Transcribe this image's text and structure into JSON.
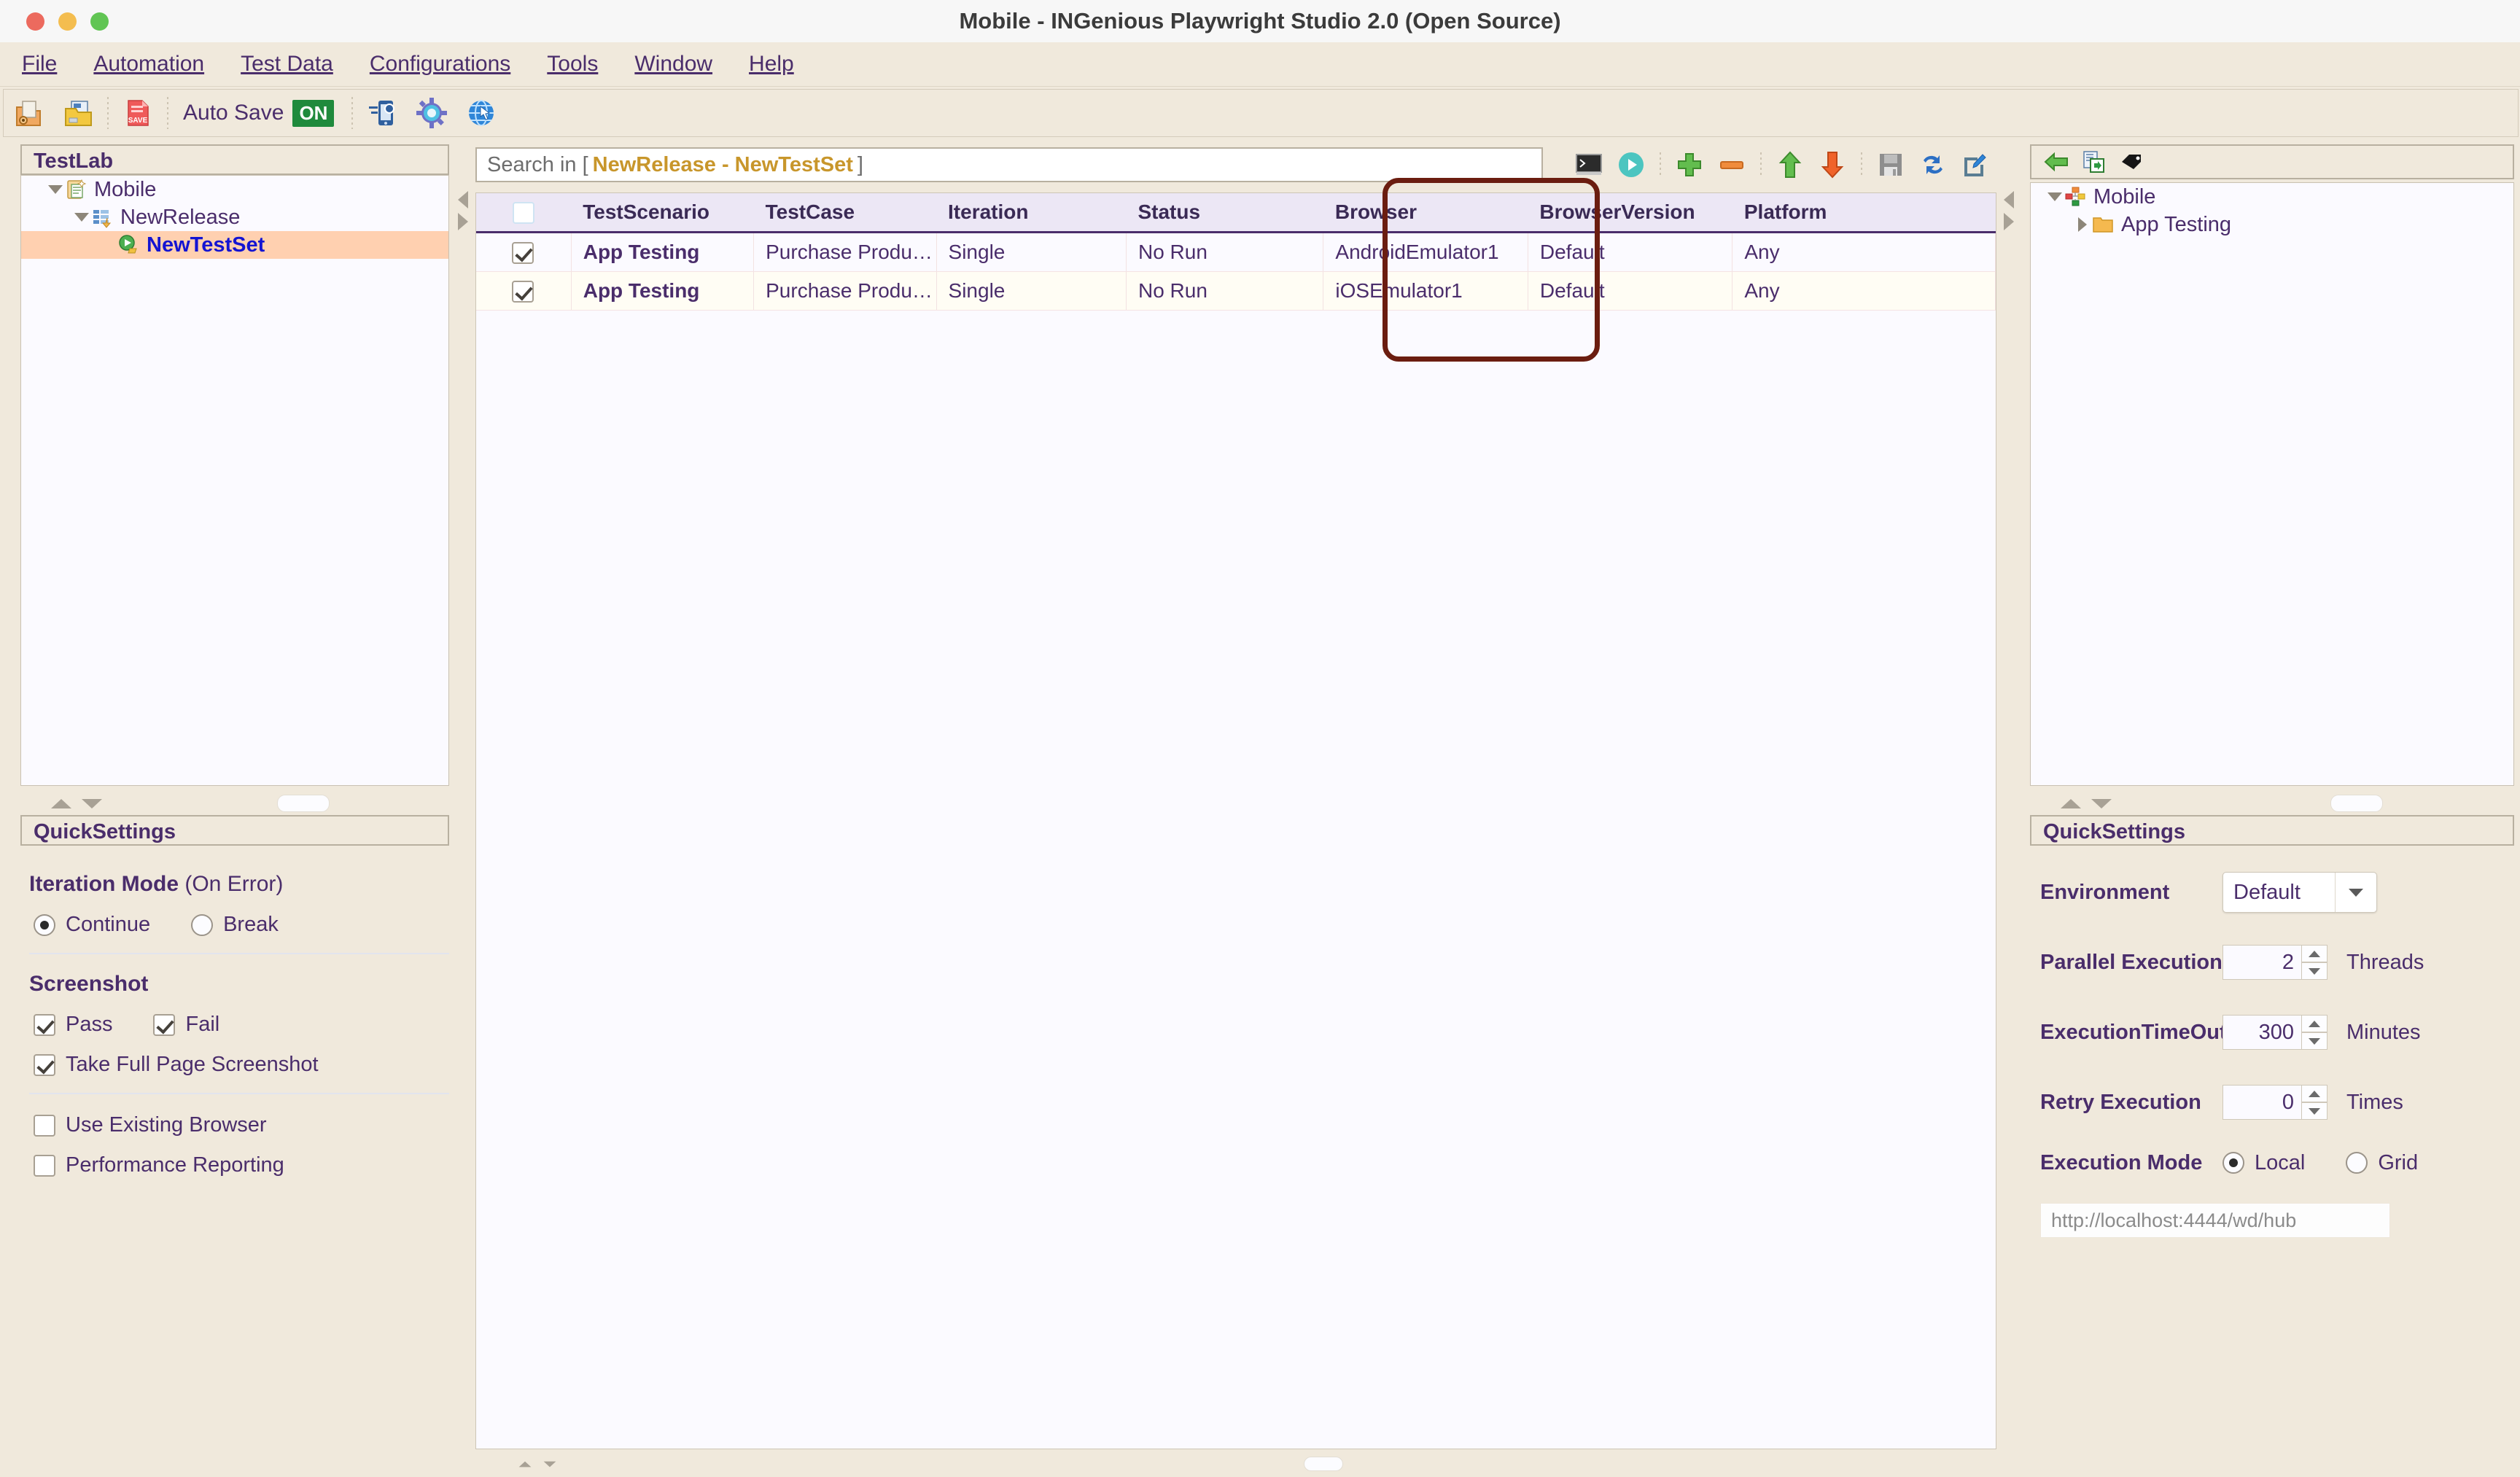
{
  "window": {
    "title": "Mobile - INGenious Playwright Studio 2.0 (Open Source)",
    "close_label": "close",
    "minimize_label": "minimize",
    "zoom_label": "zoom"
  },
  "menubar": {
    "items": [
      {
        "label": "File",
        "mnemonic": "F"
      },
      {
        "label": "Automation",
        "mnemonic": "A"
      },
      {
        "label": "Test Data",
        "mnemonic": "D"
      },
      {
        "label": "Configurations",
        "mnemonic": "C"
      },
      {
        "label": "Tools",
        "mnemonic": "T"
      },
      {
        "label": "Window",
        "mnemonic": "W"
      },
      {
        "label": "Help",
        "mnemonic": "H"
      }
    ]
  },
  "toolbar": {
    "open_icon": "open-project-icon",
    "save_project_icon": "save-project-folder-icon",
    "save_icon": "save-file-icon",
    "autosave_label": "Auto Save",
    "autosave_state": "ON",
    "mobile_config_icon": "mobile-settings-icon",
    "settings_icon": "gear-icon",
    "web_icon": "globe-pointer-icon"
  },
  "left_panel": {
    "title": "TestLab",
    "tree": [
      {
        "label": "Mobile",
        "level": 0,
        "expanded": true,
        "icon": "project-clipboard-icon",
        "selected": false
      },
      {
        "label": "NewRelease",
        "level": 1,
        "expanded": true,
        "icon": "release-list-icon",
        "selected": false
      },
      {
        "label": "NewTestSet",
        "level": 2,
        "expanded": null,
        "icon": "testset-play-icon",
        "selected": true
      }
    ]
  },
  "center": {
    "search": {
      "prefix": "Search in [",
      "scope": "NewRelease - NewTestSet",
      "suffix": "]",
      "placeholder": "Search in [ NewRelease - NewTestSet ]"
    },
    "tools": [
      {
        "name": "console-icon",
        "label": "Console"
      },
      {
        "name": "run-icon",
        "label": "Run"
      },
      {
        "name": "add-icon",
        "label": "Add"
      },
      {
        "name": "remove-icon",
        "label": "Remove"
      },
      {
        "name": "move-up-icon",
        "label": "Move Up"
      },
      {
        "name": "move-down-icon",
        "label": "Move Down"
      },
      {
        "name": "save-icon",
        "label": "Save"
      },
      {
        "name": "refresh-icon",
        "label": "Refresh"
      },
      {
        "name": "edit-icon",
        "label": "Edit"
      }
    ],
    "table": {
      "columns": [
        "",
        "TestScenario",
        "TestCase",
        "Iteration",
        "Status",
        "Browser",
        "BrowserVersion",
        "Platform"
      ],
      "header_checkbox_checked": false,
      "rows": [
        {
          "checked": true,
          "TestScenario": "App Testing",
          "TestCase": "Purchase Product_Android",
          "Iteration": "Single",
          "Status": "No Run",
          "Browser": "AndroidEmulator1",
          "BrowserVersion": "Default",
          "Platform": "Any"
        },
        {
          "checked": true,
          "TestScenario": "App Testing",
          "TestCase": "Purchase Product_iOS",
          "Iteration": "Single",
          "Status": "No Run",
          "Browser": "iOSEmulator1",
          "BrowserVersion": "Default",
          "Platform": "Any"
        }
      ]
    },
    "annotation": {
      "name": "browser-column-highlight",
      "color": "#6b1d10"
    }
  },
  "right_panel": {
    "toolbar": [
      {
        "name": "back-arrow-icon",
        "label": "Back"
      },
      {
        "name": "copy-to-icon",
        "label": "Copy To"
      },
      {
        "name": "tag-icon",
        "label": "Tag"
      }
    ],
    "tree": [
      {
        "label": "Mobile",
        "level": 0,
        "expanded": true,
        "icon": "modules-icon"
      },
      {
        "label": "App Testing",
        "level": 1,
        "expanded": false,
        "icon": "folder-icon"
      }
    ]
  },
  "quick_settings_left": {
    "title": "QuickSettings",
    "iteration_mode": {
      "label": "Iteration Mode",
      "sublabel": "(On Error)",
      "options": [
        {
          "label": "Continue",
          "selected": true
        },
        {
          "label": "Break",
          "selected": false
        }
      ]
    },
    "screenshot": {
      "label": "Screenshot",
      "options": [
        {
          "label": "Pass",
          "checked": true
        },
        {
          "label": "Fail",
          "checked": true
        }
      ],
      "full_page": {
        "label": "Take Full Page Screenshot",
        "checked": true
      }
    },
    "misc": [
      {
        "label": "Use Existing Browser",
        "checked": false
      },
      {
        "label": "Performance Reporting",
        "checked": false
      }
    ]
  },
  "quick_settings_right": {
    "title": "QuickSettings",
    "environment": {
      "label": "Environment",
      "value": "Default"
    },
    "parallel_execution": {
      "label": "Parallel Execution",
      "value": "2",
      "unit": "Threads"
    },
    "execution_timeout": {
      "label": "ExecutionTimeOut",
      "value": "300",
      "unit": "Minutes"
    },
    "retry_execution": {
      "label": "Retry Execution",
      "value": "0",
      "unit": "Times"
    },
    "execution_mode": {
      "label": "Execution Mode",
      "options": [
        {
          "label": "Local",
          "selected": true
        },
        {
          "label": "Grid",
          "selected": false
        }
      ]
    },
    "grid_url": {
      "placeholder": "http://localhost:4444/wd/hub",
      "value": ""
    }
  },
  "colors": {
    "chrome": "#f0e9dc",
    "accent_text": "#4a2d6b",
    "selection": "#ffd0b0",
    "annotation": "#6b1d10",
    "header_bg": "#ece7f5",
    "scope_text": "#c8962b"
  }
}
